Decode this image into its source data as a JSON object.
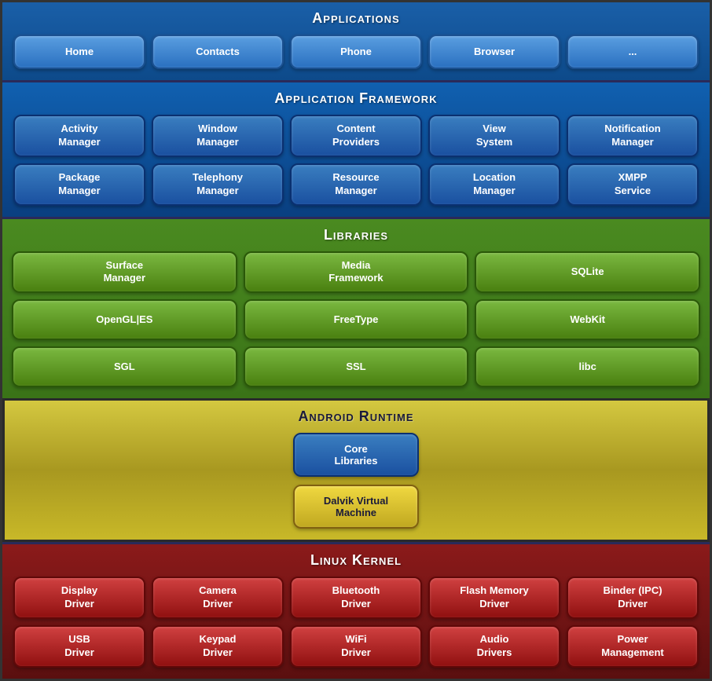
{
  "applications": {
    "title": "Applications",
    "buttons": [
      {
        "label": "Home"
      },
      {
        "label": "Contacts"
      },
      {
        "label": "Phone"
      },
      {
        "label": "Browser"
      },
      {
        "label": "..."
      }
    ]
  },
  "framework": {
    "title": "Application Framework",
    "row1": [
      {
        "label": "Activity\nManager"
      },
      {
        "label": "Window\nManager"
      },
      {
        "label": "Content\nProviders"
      },
      {
        "label": "View\nSystem"
      },
      {
        "label": "Notification\nManager"
      }
    ],
    "row2": [
      {
        "label": "Package\nManager"
      },
      {
        "label": "Telephony\nManager"
      },
      {
        "label": "Resource\nManager"
      },
      {
        "label": "Location\nManager"
      },
      {
        "label": "XMPP\nService"
      }
    ]
  },
  "libraries": {
    "title": "Libraries",
    "buttons": [
      {
        "label": "Surface\nManager"
      },
      {
        "label": "Media\nFramework"
      },
      {
        "label": "SQLite"
      },
      {
        "label": "OpenGL|ES"
      },
      {
        "label": "FreeType"
      },
      {
        "label": "WebKit"
      },
      {
        "label": "SGL"
      },
      {
        "label": "SSL"
      },
      {
        "label": "libc"
      }
    ]
  },
  "runtime": {
    "title": "Android Runtime",
    "core_libraries": "Core\nLibraries",
    "dalvik_vm": "Dalvik Virtual\nMachine"
  },
  "kernel": {
    "title": "Linux Kernel",
    "row1": [
      {
        "label": "Display\nDriver"
      },
      {
        "label": "Camera\nDriver"
      },
      {
        "label": "Bluetooth\nDriver"
      },
      {
        "label": "Flash Memory\nDriver"
      },
      {
        "label": "Binder (IPC)\nDriver"
      }
    ],
    "row2": [
      {
        "label": "USB\nDriver"
      },
      {
        "label": "Keypad\nDriver"
      },
      {
        "label": "WiFi\nDriver"
      },
      {
        "label": "Audio\nDrivers"
      },
      {
        "label": "Power\nManagement"
      }
    ]
  }
}
